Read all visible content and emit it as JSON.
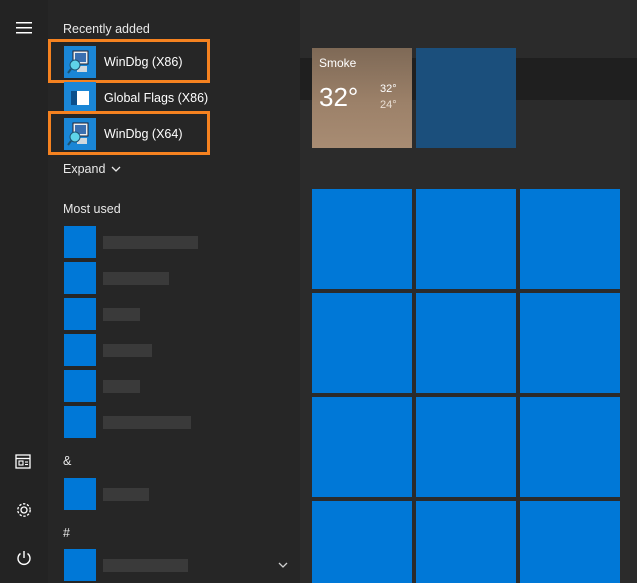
{
  "start_menu": {
    "recently_added_label": "Recently added",
    "recent_apps": [
      {
        "label": "WinDbg (X86)",
        "icon": "windbg-icon",
        "highlighted": true
      },
      {
        "label": "Global Flags (X86)",
        "icon": "gflags-icon",
        "highlighted": false
      },
      {
        "label": "WinDbg (X64)",
        "icon": "windbg-icon",
        "highlighted": true
      }
    ],
    "expand_label": "Expand",
    "most_used_label": "Most used",
    "ampersand_label": "&",
    "hash_label": "#"
  },
  "weather_tile": {
    "city": "Smoke",
    "temperature": "32°",
    "high": "32°",
    "low": "24°"
  },
  "rail": {
    "icons": [
      "hamburger-icon",
      "documents-icon",
      "settings-icon",
      "power-icon"
    ]
  },
  "colors": {
    "tile_blue": "#0078d7",
    "highlight_orange": "#f58220",
    "panel_bg": "#262626"
  }
}
